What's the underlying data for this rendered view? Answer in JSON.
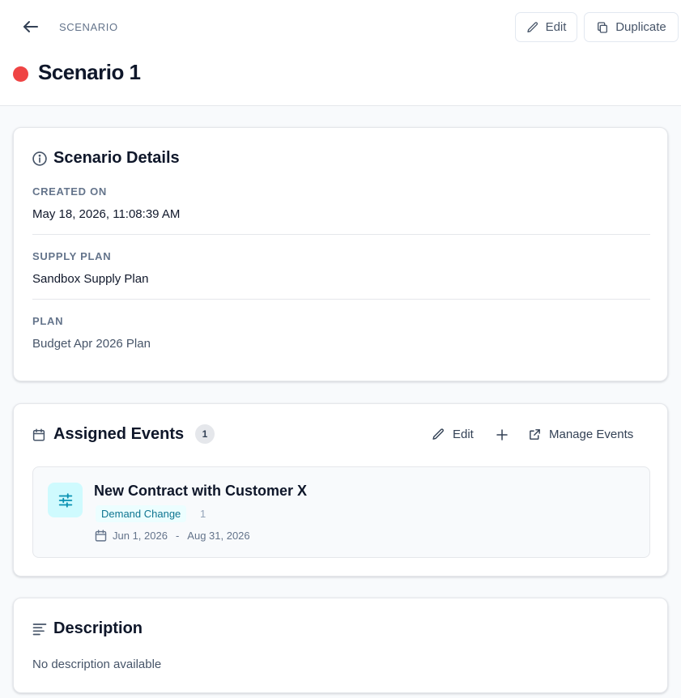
{
  "header": {
    "breadcrumb": "SCENARIO",
    "edit_label": "Edit",
    "duplicate_label": "Duplicate",
    "title": "Scenario 1",
    "status_color": "#ef4444"
  },
  "details": {
    "title": "Scenario Details",
    "created_on_label": "CREATED ON",
    "created_on_value": "May 18, 2026, 11:08:39 AM",
    "supply_plan_label": "SUPPLY PLAN",
    "supply_plan_value": "Sandbox Supply Plan",
    "plan_label": "PLAN",
    "plan_value": "Budget Apr 2026 Plan"
  },
  "events": {
    "title": "Assigned Events",
    "count": "1",
    "edit_label": "Edit",
    "manage_label": "Manage Events",
    "items": [
      {
        "name": "New Contract with Customer X",
        "type": "Demand Change",
        "quantity": "1",
        "start_date": "Jun 1, 2026",
        "separator": "-",
        "end_date": "Aug 31, 2026",
        "icon": "sliders-icon"
      }
    ]
  },
  "description": {
    "title": "Description",
    "text": "No description available"
  },
  "colors": {
    "accent_cyan": "#0e7490",
    "badge_bg": "#ecfeff",
    "status_red": "#ef4444"
  }
}
